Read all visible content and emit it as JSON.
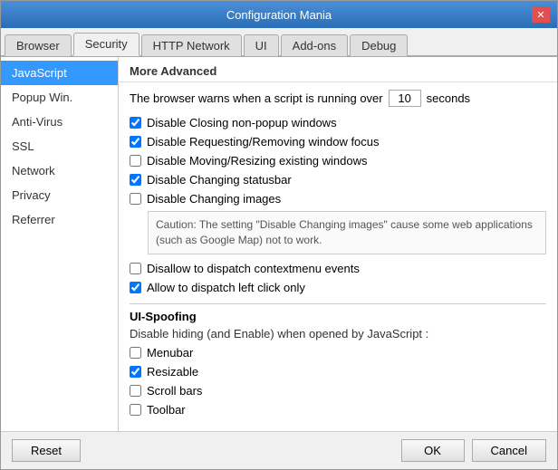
{
  "window": {
    "title": "Configuration Mania",
    "close_label": "✕"
  },
  "tabs": [
    {
      "id": "browser",
      "label": "Browser",
      "active": false
    },
    {
      "id": "security",
      "label": "Security",
      "active": true
    },
    {
      "id": "http_network",
      "label": "HTTP Network",
      "active": false
    },
    {
      "id": "ui",
      "label": "UI",
      "active": false
    },
    {
      "id": "add_ons",
      "label": "Add-ons",
      "active": false
    },
    {
      "id": "debug",
      "label": "Debug",
      "active": false
    }
  ],
  "sidebar": {
    "items": [
      {
        "id": "javascript",
        "label": "JavaScript",
        "active": true
      },
      {
        "id": "popup_win",
        "label": "Popup Win.",
        "active": false
      },
      {
        "id": "anti_virus",
        "label": "Anti-Virus",
        "active": false
      },
      {
        "id": "ssl",
        "label": "SSL",
        "active": false
      },
      {
        "id": "network",
        "label": "Network",
        "active": false
      },
      {
        "id": "privacy",
        "label": "Privacy",
        "active": false
      },
      {
        "id": "referrer",
        "label": "Referrer",
        "active": false
      }
    ]
  },
  "main": {
    "section_title": "More Advanced",
    "script_timeout": {
      "label_before": "The browser warns when a script is running over",
      "value": "10",
      "label_after": "seconds"
    },
    "checkboxes": [
      {
        "id": "disable_closing",
        "label": "Disable Closing non-popup windows",
        "checked": true
      },
      {
        "id": "disable_requesting",
        "label": "Disable Requesting/Removing window focus",
        "checked": true
      },
      {
        "id": "disable_moving",
        "label": "Disable Moving/Resizing existing windows",
        "checked": false
      },
      {
        "id": "disable_changing_statusbar",
        "label": "Disable Changing statusbar",
        "checked": true
      },
      {
        "id": "disable_changing_images",
        "label": "Disable Changing images",
        "checked": false
      }
    ],
    "caution_text": "Caution: The setting \"Disable Changing images\" cause some web applications (such as Google Map) not to work.",
    "checkboxes2": [
      {
        "id": "disallow_dispatch",
        "label": "Disallow to dispatch contextmenu events",
        "checked": false
      },
      {
        "id": "allow_left_click",
        "label": "Allow to dispatch left click only",
        "checked": true
      }
    ],
    "ui_spoofing": {
      "title": "UI-Spoofing",
      "desc": "Disable hiding (and Enable) when opened by JavaScript :",
      "checkboxes": [
        {
          "id": "menubar",
          "label": "Menubar",
          "checked": false
        },
        {
          "id": "resizable",
          "label": "Resizable",
          "checked": true
        },
        {
          "id": "scroll_bars",
          "label": "Scroll bars",
          "checked": false
        },
        {
          "id": "toolbar",
          "label": "Toolbar",
          "checked": false
        }
      ]
    }
  },
  "footer": {
    "reset_label": "Reset",
    "ok_label": "OK",
    "cancel_label": "Cancel"
  }
}
